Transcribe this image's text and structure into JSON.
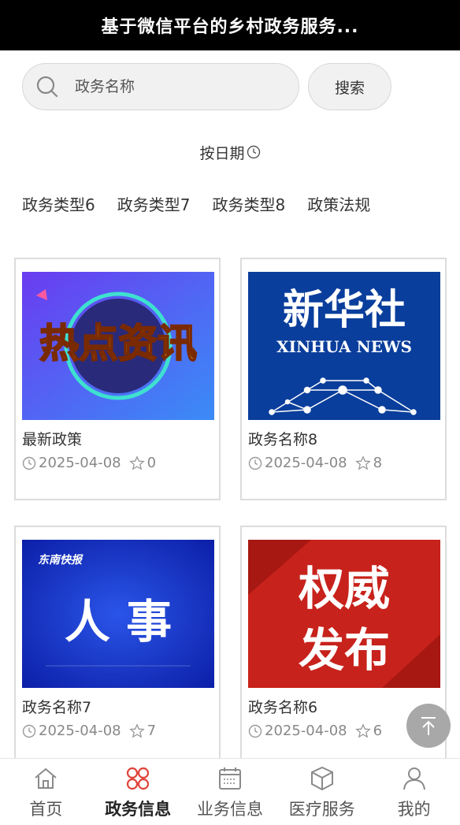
{
  "header": {
    "title": "基于微信平台的乡村政务服务..."
  },
  "search": {
    "placeholder": "政务名称",
    "button_label": "搜索"
  },
  "sort": {
    "label": "按日期"
  },
  "categories": [
    "政务类型6",
    "政务类型7",
    "政务类型8",
    "政策法规"
  ],
  "cards": [
    {
      "title": "最新政策",
      "date": "2025-04-08",
      "favorites": "0",
      "image_text": [
        "热点资讯"
      ]
    },
    {
      "title": "政务名称8",
      "date": "2025-04-08",
      "favorites": "8",
      "image_text": [
        "新华社",
        "XINHUA NEWS"
      ]
    },
    {
      "title": "政务名称7",
      "date": "2025-04-08",
      "favorites": "7",
      "image_text": [
        "东南快报",
        "人 事"
      ]
    },
    {
      "title": "政务名称6",
      "date": "2025-04-08",
      "favorites": "6",
      "image_text": [
        "权威",
        "发布"
      ]
    }
  ],
  "tabs": [
    {
      "label": "首页",
      "icon": "home-icon"
    },
    {
      "label": "政务信息",
      "icon": "grid-icon",
      "active": true
    },
    {
      "label": "业务信息",
      "icon": "calendar-icon"
    },
    {
      "label": "医疗服务",
      "icon": "box-icon"
    },
    {
      "label": "我的",
      "icon": "user-icon"
    }
  ],
  "colors": {
    "header_bg": "#000000",
    "active_tab_icon": "#e0443a",
    "tab_icon": "#8a8a8a"
  }
}
